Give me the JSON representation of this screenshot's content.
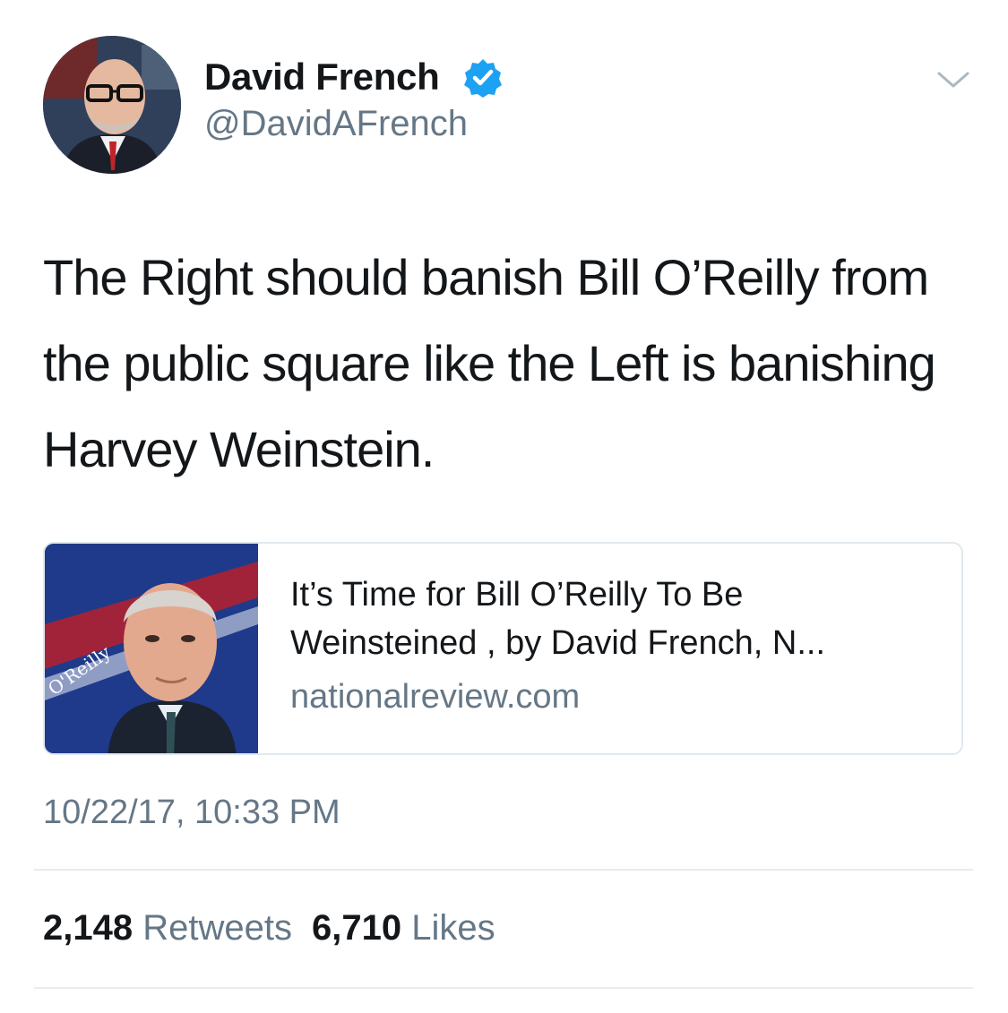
{
  "author": {
    "display_name": "David French",
    "handle": "@DavidAFrench",
    "verified": true,
    "verified_color": "#1da1f2"
  },
  "tweet": {
    "text": "The Right should banish Bill O’Reilly from the public square like the Left is banishing Harvey Weinstein.",
    "timestamp": "10/22/17, 10:33 PM"
  },
  "link_card": {
    "title": "It’s Time for Bill O’Reilly To Be Weinsteined , by David French, N...",
    "domain": "nationalreview.com",
    "thumbnail_visible_text": "O'Reilly"
  },
  "stats": {
    "retweets_count": "2,148",
    "retweets_label": "Retweets",
    "likes_count": "6,710",
    "likes_label": "Likes"
  },
  "icons": {
    "verified": "verified-badge-icon",
    "menu": "chevron-down-icon"
  }
}
